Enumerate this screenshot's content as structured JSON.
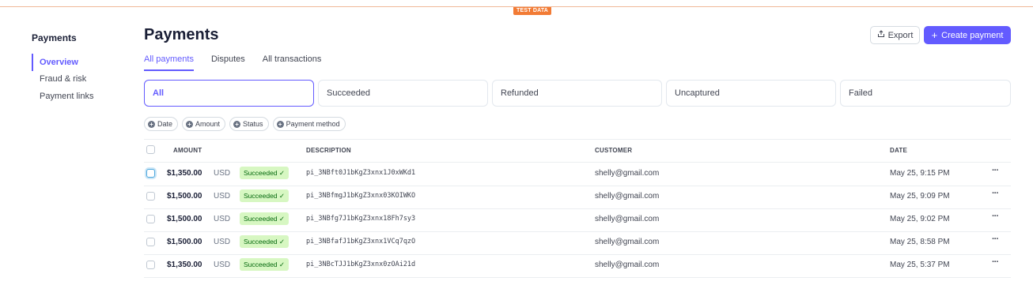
{
  "test_badge": "TEST DATA",
  "sidebar": {
    "title": "Payments",
    "items": [
      {
        "label": "Overview",
        "active": true
      },
      {
        "label": "Fraud & risk"
      },
      {
        "label": "Payment links"
      }
    ]
  },
  "header": {
    "title": "Payments",
    "export_label": "Export",
    "create_label": "Create payment"
  },
  "tabs": [
    {
      "label": "All payments",
      "active": true
    },
    {
      "label": "Disputes"
    },
    {
      "label": "All transactions"
    }
  ],
  "filters": [
    {
      "label": "All",
      "selected": true
    },
    {
      "label": "Succeeded"
    },
    {
      "label": "Refunded"
    },
    {
      "label": "Uncaptured"
    },
    {
      "label": "Failed"
    }
  ],
  "chips": [
    "Date",
    "Amount",
    "Status",
    "Payment method"
  ],
  "table": {
    "headers": {
      "amount": "AMOUNT",
      "description": "DESCRIPTION",
      "customer": "CUSTOMER",
      "date": "DATE"
    },
    "rows": [
      {
        "amount": "$1,350.00",
        "currency": "USD",
        "status": "Succeeded ✓",
        "description": "pi_3NBft0J1bKgZ3xnx1J0xWKd1",
        "customer": "shelly@gmail.com",
        "date": "May 25, 9:15 PM",
        "more": "···"
      },
      {
        "amount": "$1,500.00",
        "currency": "USD",
        "status": "Succeeded ✓",
        "description": "pi_3NBfmgJ1bKgZ3xnx03KOIWKO",
        "customer": "shelly@gmail.com",
        "date": "May 25, 9:09 PM",
        "more": "···"
      },
      {
        "amount": "$1,500.00",
        "currency": "USD",
        "status": "Succeeded ✓",
        "description": "pi_3NBfg7J1bKgZ3xnx18Fh7sy3",
        "customer": "shelly@gmail.com",
        "date": "May 25, 9:02 PM",
        "more": "···"
      },
      {
        "amount": "$1,500.00",
        "currency": "USD",
        "status": "Succeeded ✓",
        "description": "pi_3NBfafJ1bKgZ3xnx1VCq7qzO",
        "customer": "shelly@gmail.com",
        "date": "May 25, 8:58 PM",
        "more": "···"
      },
      {
        "amount": "$1,350.00",
        "currency": "USD",
        "status": "Succeeded ✓",
        "description": "pi_3NBcTJJ1bKgZ3xnx0zOAi21d",
        "customer": "shelly@gmail.com",
        "date": "May 25, 5:37 PM",
        "more": "···"
      }
    ]
  },
  "colors": {
    "accent": "#635bff",
    "success_bg": "#d7f7c2",
    "success_text": "#05690d",
    "test_badge": "#f27b35"
  },
  "icons": {
    "export": "export-icon",
    "create": "plus-icon",
    "filter_add": "plus-circle-icon",
    "row_menu": "more-icon"
  }
}
